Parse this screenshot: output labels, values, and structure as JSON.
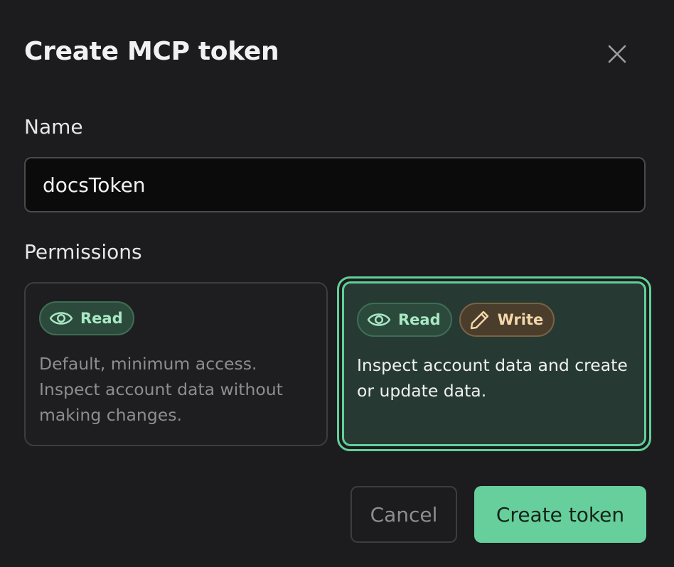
{
  "dialog": {
    "title": "Create MCP token",
    "close_icon": "close-icon"
  },
  "name_field": {
    "label": "Name",
    "value": "docsToken"
  },
  "permissions": {
    "label": "Permissions",
    "selected": "read-write",
    "options": [
      {
        "id": "read",
        "badges": [
          {
            "label": "Read",
            "icon": "eye-icon"
          }
        ],
        "description": "Default, minimum access. Inspect account data without making changes."
      },
      {
        "id": "read-write",
        "badges": [
          {
            "label": "Read",
            "icon": "eye-icon"
          },
          {
            "label": "Write",
            "icon": "pencil-icon"
          }
        ],
        "description": "Inspect account data and create or update data."
      }
    ]
  },
  "actions": {
    "cancel_label": "Cancel",
    "create_label": "Create token"
  },
  "colors": {
    "background": "#1c1c1e",
    "accent": "#66cf9b",
    "selected_card_bg": "#263a33",
    "read_badge_text": "#a9e8c4",
    "write_badge_text": "#f3d6a9"
  }
}
